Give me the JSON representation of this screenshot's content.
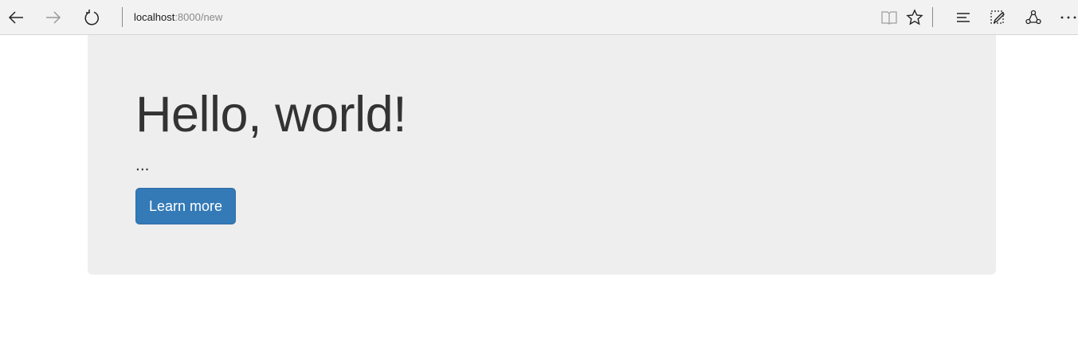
{
  "browser": {
    "address_host": "localhost",
    "address_rest": ":8000/new",
    "icons": [
      "back-icon",
      "forward-icon",
      "refresh-icon",
      "reading-view-icon",
      "favorite-star-icon",
      "hub-icon",
      "web-note-icon",
      "share-icon",
      "more-icon"
    ]
  },
  "jumbotron": {
    "heading": "Hello, world!",
    "lead": "...",
    "button_label": "Learn more"
  },
  "colors": {
    "primary_button": "#337ab7",
    "jumbotron_bg": "#eeeeee",
    "heading_text": "#333333"
  }
}
